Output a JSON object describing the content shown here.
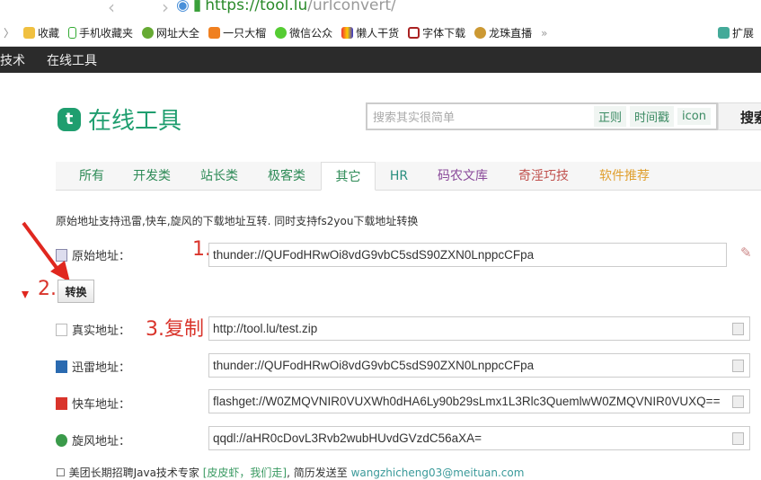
{
  "browser": {
    "url_host": "https://tool.lu",
    "url_path": "/urlconvert/",
    "bookmarks": [
      "收藏",
      "手机收藏夹",
      "网址大全",
      "一只大榴",
      "微信公众",
      "懒人干货",
      "字体下载",
      "龙珠直播"
    ],
    "more": "»",
    "extensions": "扩展"
  },
  "topnav": [
    "技术",
    "在线工具"
  ],
  "logo": {
    "icon": "t",
    "text": "在线工具"
  },
  "search": {
    "placeholder": "搜索其实很简单",
    "tags": [
      "正则",
      "时间戳",
      "icon"
    ],
    "button": "搜索"
  },
  "tabs": [
    {
      "label": "所有",
      "color": "#2e8b57"
    },
    {
      "label": "开发类",
      "color": "#2e8b57"
    },
    {
      "label": "站长类",
      "color": "#2e8b57"
    },
    {
      "label": "极客类",
      "color": "#2e8b57"
    },
    {
      "label": "其它",
      "color": "#2e8b57"
    },
    {
      "label": "HR",
      "color": "#2a8f7f"
    },
    {
      "label": "码农文库",
      "color": "#8a4a9a"
    },
    {
      "label": "奇淫巧技",
      "color": "#c0504d"
    },
    {
      "label": "软件推荐",
      "color": "#e0a030"
    }
  ],
  "description": "原始地址支持迅雷,快车,旋风的下载地址互转. 同时支持fs2you下载地址转换",
  "original": {
    "label": "原始地址：",
    "value": "thunder://QUFodHRwOi8vdG9vbC5sdS90ZXN0LnppcCFpa"
  },
  "convert_button": "转换",
  "results": [
    {
      "label": "真实地址：",
      "value": "http://tool.lu/test.zip"
    },
    {
      "label": "迅雷地址：",
      "value": "thunder://QUFodHRwOi8vdG9vbC5sdS90ZXN0LnppcCFpa"
    },
    {
      "label": "快车地址：",
      "value": "flashget://W0ZMQVNIR0VUXWh0dHA6Ly90b29sLmx1L3Rlc3QuemlwW0ZMQVNIR0VUXQ=="
    },
    {
      "label": "旋风地址：",
      "value": "qqdl://aHR0cDovL3Rvb2wubHUvdGVzdC56aXA="
    }
  ],
  "annotations": [
    "1.",
    "2.",
    "3.复制"
  ],
  "footer": {
    "prefix": "☐ 美团长期招聘Java技术专家 ",
    "link": "[皮皮虾，我们走]",
    "mid": ", 简历发送至 ",
    "email": "wangzhicheng03@meituan.com"
  }
}
